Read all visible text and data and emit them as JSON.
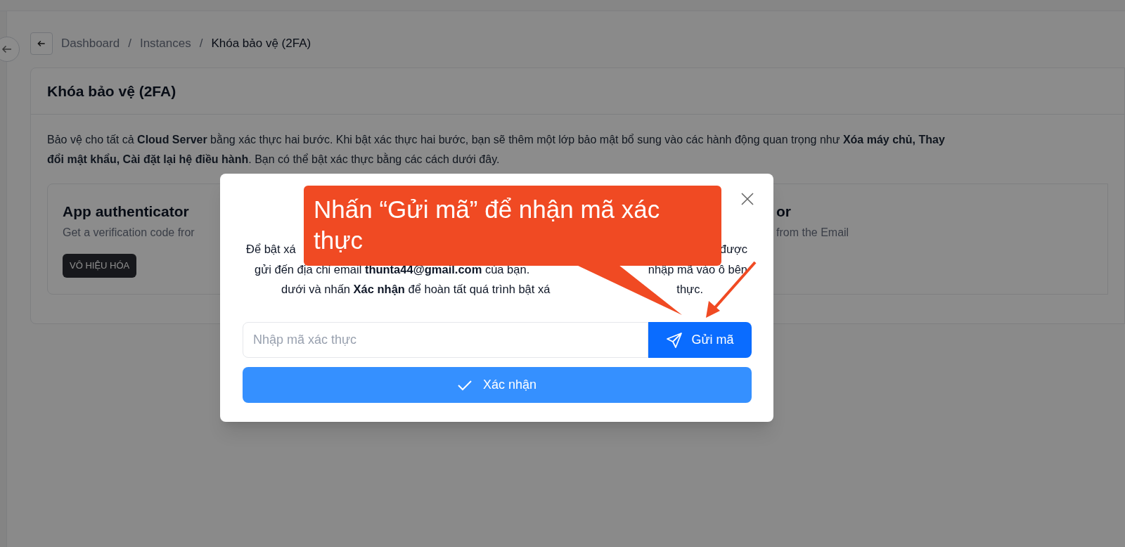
{
  "breadcrumb": [
    {
      "label": "Dashboard",
      "selected": false
    },
    {
      "label": "Instances",
      "selected": false
    },
    {
      "label": "Khóa bảo vệ (2FA)",
      "selected": true
    }
  ],
  "breadcrumb_separator": "/",
  "card": {
    "title": "Khóa bảo vệ (2FA)",
    "description": "Bảo vệ cho tất cả **Cloud Server** bằng xác thực hai bước. Khi bật xác thực hai bước, bạn sẽ thêm một lớp bảo mật bổ sung vào các hành động quan trọng như **Xóa máy chủ, Thay đổi mật khẩu, Cài đặt lại hệ điều hành**. Bạn có thể bật xác thực bằng các cách dưới đây."
  },
  "methods": [
    {
      "title": "App authenticator",
      "subtitle": "Get a verification code fror",
      "button": "VÔ HIỆU HÓA"
    },
    {
      "title": "or",
      "subtitle": "from the Email"
    }
  ],
  "modal": {
    "text_lines": [
      {
        "left": "Để bật xá",
        "right": "được"
      },
      {
        "left": "gửi đến địa chỉ email **thunta44@gmail.com** của bạn.",
        "right": "nhập mã vào ô bên"
      },
      {
        "left": "dưới và nhấn **Xác nhận** để hoàn tất quá trình bật xá",
        "right": "thực."
      }
    ],
    "code_field": {
      "placeholder": "Nhập mã xác thực"
    },
    "send_button": "Gửi mã",
    "confirm_button": "Xác nhận"
  },
  "callout": {
    "text": "Nhấn “Gửi mã” để nhận mã xác thực"
  }
}
